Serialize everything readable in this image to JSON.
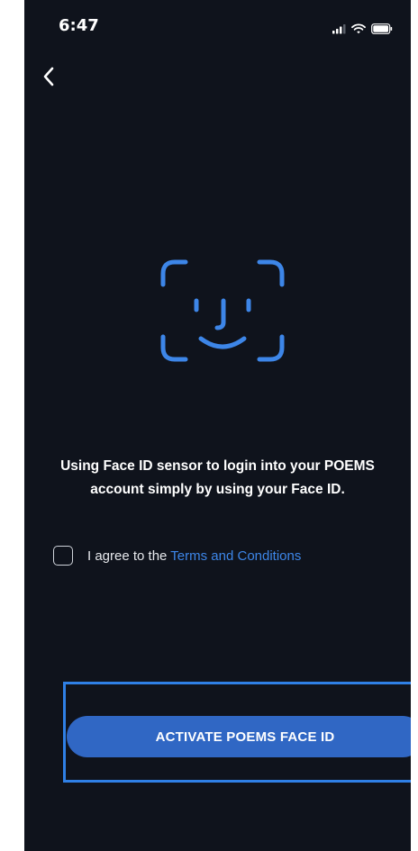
{
  "status_bar": {
    "time": "6:47",
    "icons": [
      "signal-icon",
      "wifi-icon",
      "battery-icon"
    ]
  },
  "header": {
    "back_icon": "chevron-left-icon"
  },
  "hero": {
    "icon": "face-id-icon",
    "icon_color": "#3d86e8"
  },
  "description": {
    "line1": "Using Face ID sensor to login into your POEMS",
    "line2": "account simply by using your Face ID."
  },
  "agreement": {
    "checked": false,
    "prefix": "I agree to the ",
    "link_text": "Terms and Conditions",
    "link_color": "#3d86e8"
  },
  "actions": {
    "activate_label": "ACTIVATE POEMS FACE ID",
    "button_color": "#3067c4"
  },
  "colors": {
    "background": "#0f131c",
    "highlight": "#2f80e6"
  }
}
